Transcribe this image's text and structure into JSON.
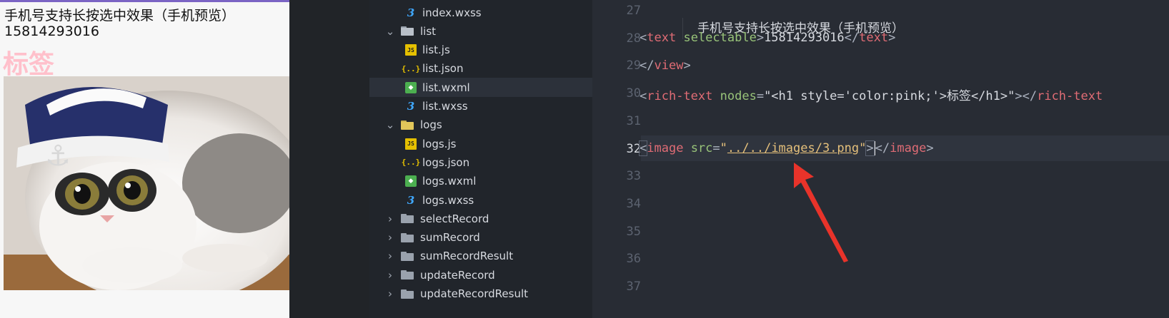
{
  "preview": {
    "line1": "手机号支持长按选中效果（手机预览）",
    "line2": "15814293016",
    "rich_text": "标签",
    "image_alt": "cat-photo"
  },
  "tree": {
    "items": [
      {
        "label": "index.wxss",
        "type": "wxss",
        "indent": 2
      },
      {
        "label": "list",
        "type": "folder-open",
        "indent": 1
      },
      {
        "label": "list.js",
        "type": "js",
        "indent": 2
      },
      {
        "label": "list.json",
        "type": "json",
        "indent": 2
      },
      {
        "label": "list.wxml",
        "type": "wxml",
        "indent": 2,
        "selected": true
      },
      {
        "label": "list.wxss",
        "type": "wxss",
        "indent": 2
      },
      {
        "label": "logs",
        "type": "folder-yellow",
        "indent": 1
      },
      {
        "label": "logs.js",
        "type": "js",
        "indent": 2
      },
      {
        "label": "logs.json",
        "type": "json",
        "indent": 2
      },
      {
        "label": "logs.wxml",
        "type": "wxml",
        "indent": 2
      },
      {
        "label": "logs.wxss",
        "type": "wxss",
        "indent": 2
      },
      {
        "label": "selectRecord",
        "type": "folder",
        "indent": 1
      },
      {
        "label": "sumRecord",
        "type": "folder",
        "indent": 1
      },
      {
        "label": "sumRecordResult",
        "type": "folder",
        "indent": 1
      },
      {
        "label": "updateRecord",
        "type": "folder",
        "indent": 1
      },
      {
        "label": "updateRecordResult",
        "type": "folder",
        "indent": 1
      }
    ],
    "icon_text": {
      "js": "JS",
      "json": "{..}",
      "wxml": "◆",
      "wxss": "3"
    }
  },
  "editor": {
    "line_numbers": [
      "27",
      "28",
      "29",
      "30",
      "31",
      "32",
      "33",
      "34",
      "35",
      "36",
      "37"
    ],
    "active_line": "32",
    "lines": {
      "l27_text": "手机号支持长按选中效果（手机预览）",
      "l28_open": "<",
      "l28_tag": "text",
      "l28_attr": "selectable",
      "l28_gt": ">",
      "l28_content": "15814293016",
      "l28_close_lt": "</",
      "l28_close_tag": "text",
      "l28_close_gt": ">",
      "l29_lt": "</",
      "l29_tag": "view",
      "l29_gt": ">",
      "l30_lt": "<",
      "l30_tag": "rich-text",
      "l30_attr": "nodes",
      "l30_eq": "=",
      "l30_str1": "\"<h1 style='color:pink;'>",
      "l30_cn": "标签",
      "l30_str2": "</h1>\"",
      "l30_gt": ">",
      "l30_close_lt": "</",
      "l30_close_tag": "rich-text",
      "l32_lt": "<",
      "l32_tag": "image",
      "l32_attr": "src",
      "l32_eq": "=",
      "l32_q1": "\"",
      "l32_path": "../../images/3.png",
      "l32_q2": "\"",
      "l32_gt": ">",
      "l32_close_lt": "</",
      "l32_close_tag": "image",
      "l32_close_gt": ">"
    }
  },
  "colors": {
    "accent_arrow": "#e8332a",
    "preview_border": "#7b64c4",
    "rich_text_color": "#ffc0cb"
  }
}
